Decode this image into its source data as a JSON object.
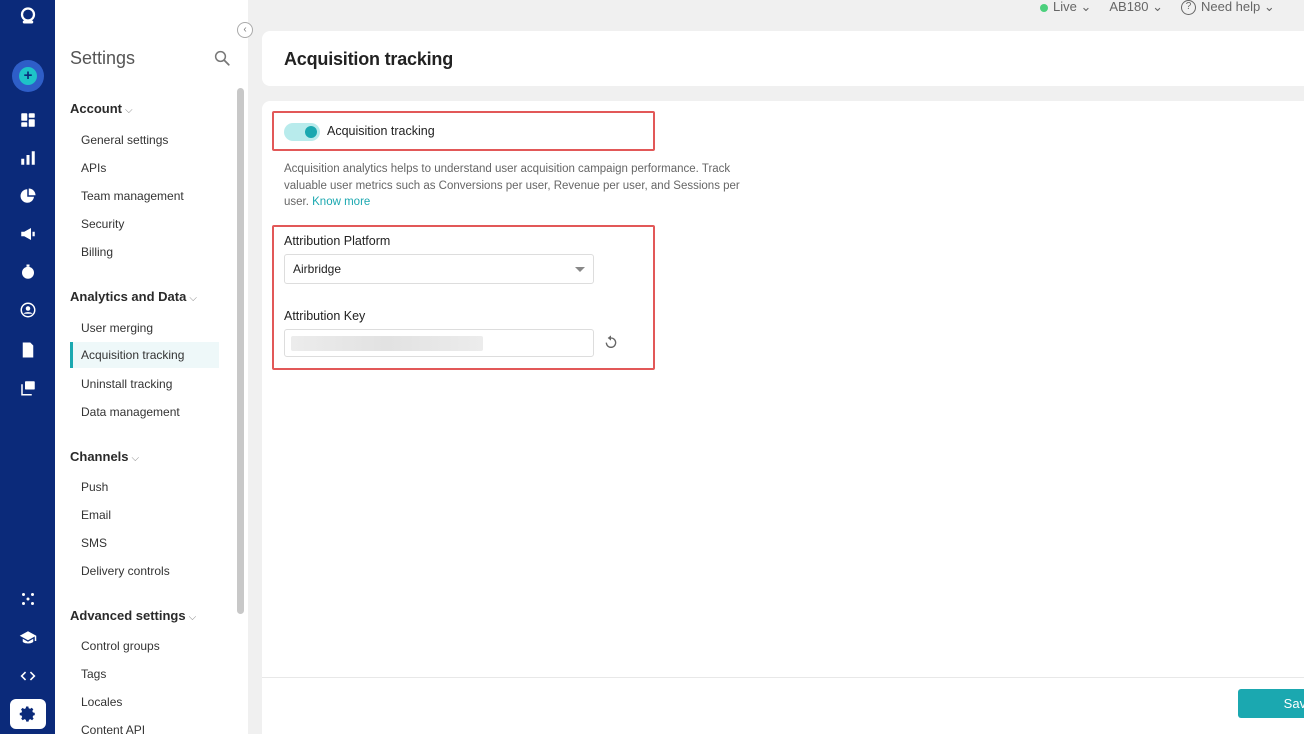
{
  "topbar": {
    "env_label": "Live",
    "app_label": "AB180",
    "help_label": "Need help"
  },
  "sidebar": {
    "title": "Settings",
    "sections": [
      {
        "title": "Account",
        "items": [
          "General settings",
          "APIs",
          "Team management",
          "Security",
          "Billing"
        ]
      },
      {
        "title": "Analytics and Data",
        "items": [
          "User merging",
          "Acquisition tracking",
          "Uninstall tracking",
          "Data management"
        ]
      },
      {
        "title": "Channels",
        "items": [
          "Push",
          "Email",
          "SMS",
          "Delivery controls"
        ]
      },
      {
        "title": "Advanced settings",
        "items": [
          "Control groups",
          "Tags",
          "Locales",
          "Content API"
        ]
      }
    ],
    "active_item": "Acquisition tracking"
  },
  "page": {
    "title": "Acquisition tracking",
    "toggle_label": "Acquisition tracking",
    "toggle_on": true,
    "description": "Acquisition analytics helps to understand user acquisition campaign performance. Track valuable user metrics such as Conversions per user, Revenue per user, and Sessions per user.",
    "know_more": "Know more",
    "platform_label": "Attribution Platform",
    "platform_value": "Airbridge",
    "key_label": "Attribution Key",
    "save_label": "Save"
  },
  "colors": {
    "rail": "#0b2a7a",
    "accent": "#1ba8b0",
    "highlight": "#e25858"
  }
}
